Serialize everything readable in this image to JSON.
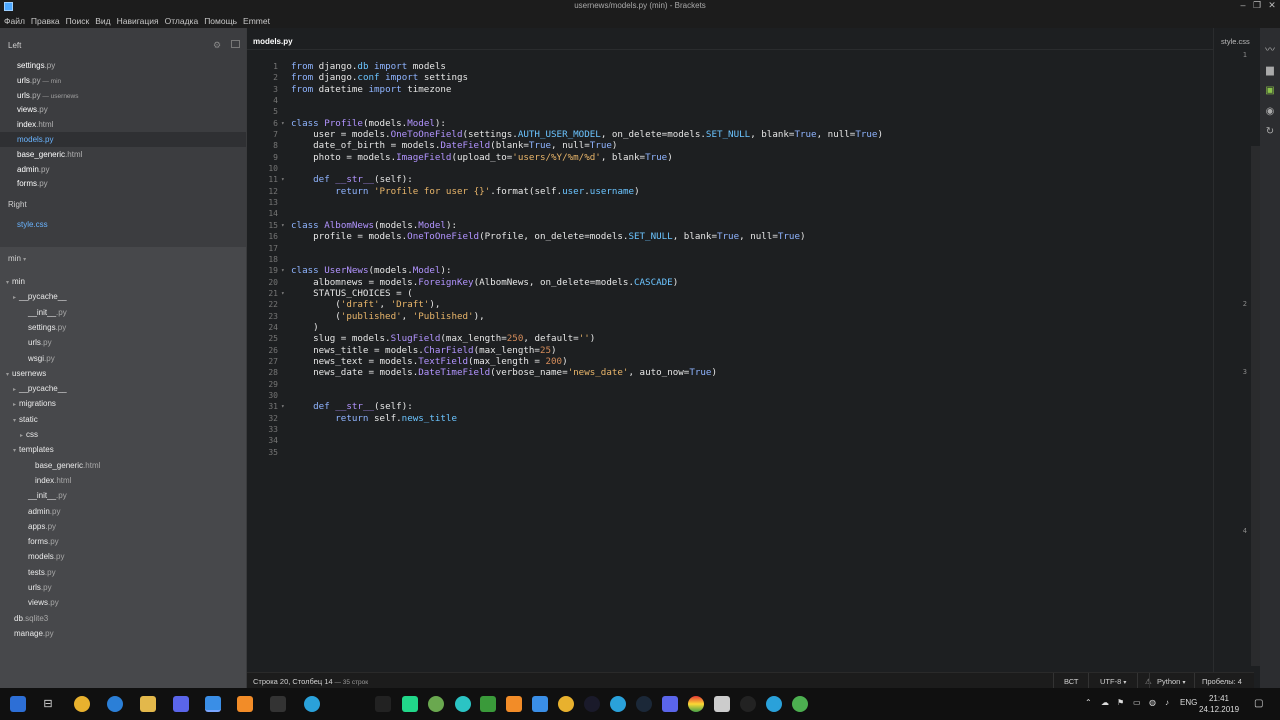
{
  "window": {
    "title": "usernews/models.py (min) - Brackets"
  },
  "menu": [
    "Файл",
    "Правка",
    "Поиск",
    "Вид",
    "Навигация",
    "Отладка",
    "Помощь",
    "Emmet"
  ],
  "sidebar": {
    "left_label": "Left",
    "right_label": "Right",
    "working_left": [
      {
        "name": "settings",
        "ext": ".py",
        "suffix": ""
      },
      {
        "name": "urls",
        "ext": ".py",
        "suffix": " — min"
      },
      {
        "name": "urls",
        "ext": ".py",
        "suffix": " — usernews"
      },
      {
        "name": "views",
        "ext": ".py",
        "suffix": ""
      },
      {
        "name": "index",
        "ext": ".html",
        "suffix": ""
      },
      {
        "name": "models",
        "ext": ".py",
        "suffix": ""
      },
      {
        "name": "base_generic",
        "ext": ".html",
        "suffix": ""
      },
      {
        "name": "admin",
        "ext": ".py",
        "suffix": ""
      },
      {
        "name": "forms",
        "ext": ".py",
        "suffix": ""
      }
    ],
    "working_right": [
      {
        "name": "style",
        "ext": ".css",
        "suffix": ""
      }
    ],
    "project_label": "min",
    "tree": [
      {
        "name": "min",
        "ext": "",
        "indent": 1,
        "arrow": "▾"
      },
      {
        "name": "__pycache__",
        "ext": "",
        "indent": 2,
        "arrow": "▸"
      },
      {
        "name": "__init__",
        "ext": ".py",
        "indent": 3,
        "arrow": ""
      },
      {
        "name": "settings",
        "ext": ".py",
        "indent": 3,
        "arrow": ""
      },
      {
        "name": "urls",
        "ext": ".py",
        "indent": 3,
        "arrow": ""
      },
      {
        "name": "wsgi",
        "ext": ".py",
        "indent": 3,
        "arrow": ""
      },
      {
        "name": "usernews",
        "ext": "",
        "indent": 1,
        "arrow": "▾"
      },
      {
        "name": "__pycache__",
        "ext": "",
        "indent": 2,
        "arrow": "▸"
      },
      {
        "name": "migrations",
        "ext": "",
        "indent": 2,
        "arrow": "▸"
      },
      {
        "name": "static",
        "ext": "",
        "indent": 2,
        "arrow": "▾"
      },
      {
        "name": "css",
        "ext": "",
        "indent": 3,
        "arrow": "▸"
      },
      {
        "name": "templates",
        "ext": "",
        "indent": 2,
        "arrow": "▾"
      },
      {
        "name": "base_generic",
        "ext": ".html",
        "indent": 4,
        "arrow": ""
      },
      {
        "name": "index",
        "ext": ".html",
        "indent": 4,
        "arrow": ""
      },
      {
        "name": "__init__",
        "ext": ".py",
        "indent": 3,
        "arrow": ""
      },
      {
        "name": "admin",
        "ext": ".py",
        "indent": 3,
        "arrow": ""
      },
      {
        "name": "apps",
        "ext": ".py",
        "indent": 3,
        "arrow": ""
      },
      {
        "name": "forms",
        "ext": ".py",
        "indent": 3,
        "arrow": ""
      },
      {
        "name": "models",
        "ext": ".py",
        "indent": 3,
        "arrow": ""
      },
      {
        "name": "tests",
        "ext": ".py",
        "indent": 3,
        "arrow": ""
      },
      {
        "name": "urls",
        "ext": ".py",
        "indent": 3,
        "arrow": ""
      },
      {
        "name": "views",
        "ext": ".py",
        "indent": 3,
        "arrow": ""
      },
      {
        "name": "db",
        "ext": ".sqlite3",
        "indent": 1,
        "arrow": ""
      },
      {
        "name": "manage",
        "ext": ".py",
        "indent": 1,
        "arrow": ""
      }
    ]
  },
  "editor": {
    "tab": "models.py",
    "lines": [
      "<k>from</k> django.<c>db</c> <k>import</k> models",
      "<k>from</k> django.<c>conf</c> <k>import</k> settings",
      "<k>from</k> datetime <k>import</k> timezone",
      "",
      "",
      "<k>class</k> <f>Profile</f>(models.<f>Model</f>):",
      "    user = models.<f>OneToOneField</f>(settings.<c>AUTH_USER_MODEL</c>, on_delete=models.<c>SET_NULL</c>, blank=<k>True</k>, null=<k>True</k>)",
      "    date_of_birth = models.<f>DateField</f>(blank=<k>True</k>, null=<k>True</k>)",
      "    photo = models.<f>ImageField</f>(upload_to=<s>'users/%Y/%m/%d'</s>, blank=<k>True</k>)",
      "",
      "    <k>def</k> <f>__str__</f>(self):",
      "        <k>return</k> <s>'Profile for user {}'</s>.format(self.<c>user</c>.<c>username</c>)",
      "",
      "",
      "<k>class</k> <f>AlbomNews</f>(models.<f>Model</f>):",
      "    profile = models.<f>OneToOneField</f>(Profile, on_delete=models.<c>SET_NULL</c>, blank=<k>True</k>, null=<k>True</k>)",
      "",
      "",
      "<k>class</k> <f>UserNews</f>(models.<f>Model</f>):",
      "    albomnews = models.<f>ForeignKey</f>(AlbomNews, on_delete=models.<c>CASCADE</c>)",
      "    STATUS_CHOICES = (",
      "        (<s>'draft'</s>, <s>'Draft'</s>),",
      "        (<s>'published'</s>, <s>'Published'</s>),",
      "    )",
      "    slug = models.<f>SlugField</f>(max_length=<n>250</n>, default=<s>''</s>)",
      "    news_title = models.<f>CharField</f>(max_length=<n>25</n>)",
      "    news_text = models.<f>TextField</f>(max_length = <n>200</n>)",
      "    news_date = models.<f>DateTimeField</f>(verbose_name=<s>'news_date'</s>, auto_now=<k>True</k>)",
      "",
      "",
      "    <k>def</k> <f>__str__</f>(self):",
      "        <k>return</k> self.<c>news_title</c>",
      "",
      "",
      ""
    ],
    "fold_lines": [
      6,
      11,
      15,
      19,
      21,
      31
    ]
  },
  "right_pane": {
    "tab": "style.css",
    "line_numbers": [
      "1",
      "2",
      "3",
      "4"
    ]
  },
  "status": {
    "position": "Строка 20, Столбец 14",
    "lines": " — 35 строк",
    "ins": "ВСТ",
    "encoding": "UTF-8",
    "language": "Python",
    "spaces": "Пробелы: 4"
  },
  "taskbar": {
    "lang": "ENG",
    "time": "21:41",
    "date": "24.12.2019"
  }
}
